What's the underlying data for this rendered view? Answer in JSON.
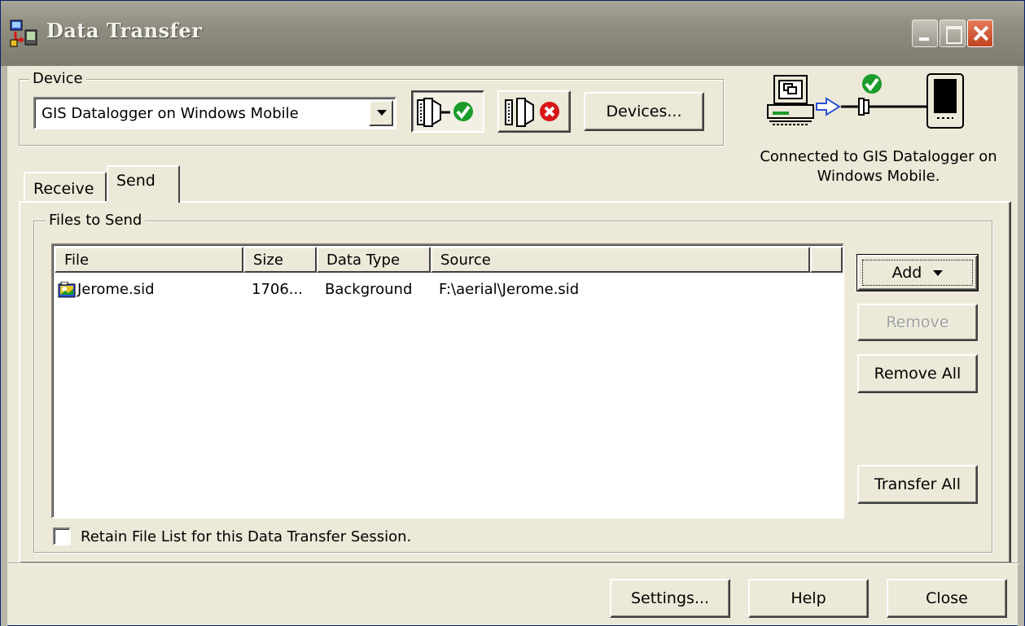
{
  "window": {
    "title": "Data Transfer"
  },
  "device": {
    "group_label": "Device",
    "selected_device": "GIS Datalogger on Windows Mobile",
    "devices_button": "Devices..."
  },
  "status": {
    "line1": "Connected to GIS Datalogger on",
    "line2": "Windows Mobile."
  },
  "tabs": [
    {
      "label": "Receive",
      "active": false
    },
    {
      "label": "Send",
      "active": true
    }
  ],
  "files": {
    "group_label": "Files to Send",
    "columns": [
      "File",
      "Size",
      "Data Type",
      "Source"
    ],
    "rows": [
      {
        "file": "Jerome.sid",
        "size": "1706...",
        "data_type": "Background",
        "source": "F:\\aerial\\Jerome.sid"
      }
    ],
    "buttons": {
      "add": "Add",
      "remove": "Remove",
      "remove_all": "Remove All",
      "transfer_all": "Transfer All"
    },
    "retain_label": "Retain File List for this Data Transfer Session."
  },
  "footer": {
    "settings": "Settings...",
    "help": "Help",
    "close": "Close"
  },
  "colors": {
    "face": "#ece9d8",
    "connect_green": "#1a9c2a",
    "disconnect_red": "#d81818",
    "arrow_blue": "#2a4fd8"
  }
}
